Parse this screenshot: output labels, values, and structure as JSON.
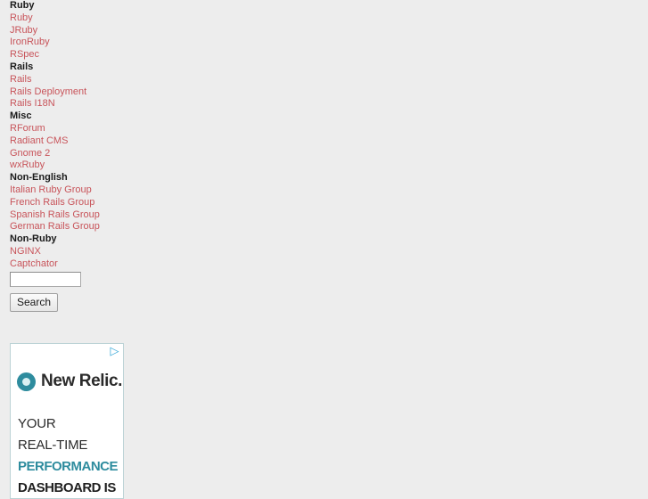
{
  "page": {
    "background_color": "#ededed",
    "link_color": "#c8545a",
    "header_color": "#1a1a1a"
  },
  "sidebar": {
    "groups": [
      {
        "header": "Ruby",
        "links": [
          {
            "label": "Ruby"
          },
          {
            "label": "JRuby"
          },
          {
            "label": "IronRuby"
          },
          {
            "label": "RSpec"
          }
        ]
      },
      {
        "header": "Rails",
        "links": [
          {
            "label": "Rails"
          },
          {
            "label": "Rails Deployment"
          },
          {
            "label": "Rails I18N"
          }
        ]
      },
      {
        "header": "Misc",
        "links": [
          {
            "label": "RForum"
          },
          {
            "label": "Radiant CMS"
          },
          {
            "label": "Gnome 2"
          },
          {
            "label": "wxRuby"
          }
        ]
      },
      {
        "header": "Non-English",
        "links": [
          {
            "label": "Italian Ruby Group"
          },
          {
            "label": "French Rails Group"
          },
          {
            "label": "Spanish Rails Group"
          },
          {
            "label": "German Rails Group"
          }
        ]
      },
      {
        "header": "Non-Ruby",
        "links": [
          {
            "label": "NGINX"
          },
          {
            "label": "Captchator"
          }
        ]
      }
    ]
  },
  "search": {
    "value": "",
    "placeholder": "",
    "button_label": "Search"
  },
  "advertisement": {
    "ad_choices_icon": "ad-choices-triangle-icon",
    "ad_choices_glyph": "▷",
    "brand_name": "New Relic.",
    "brand_logo_icon": "new-relic-ring-logo-icon",
    "accent_color": "#2e8c9e",
    "copy_lines": [
      {
        "text": "YOUR",
        "style": "plain"
      },
      {
        "text": "REAL-TIME",
        "style": "plain"
      },
      {
        "text": "PERFORMANCE",
        "style": "highlight"
      },
      {
        "text": "DASHBOARD IS",
        "style": "bold-dark"
      }
    ]
  }
}
